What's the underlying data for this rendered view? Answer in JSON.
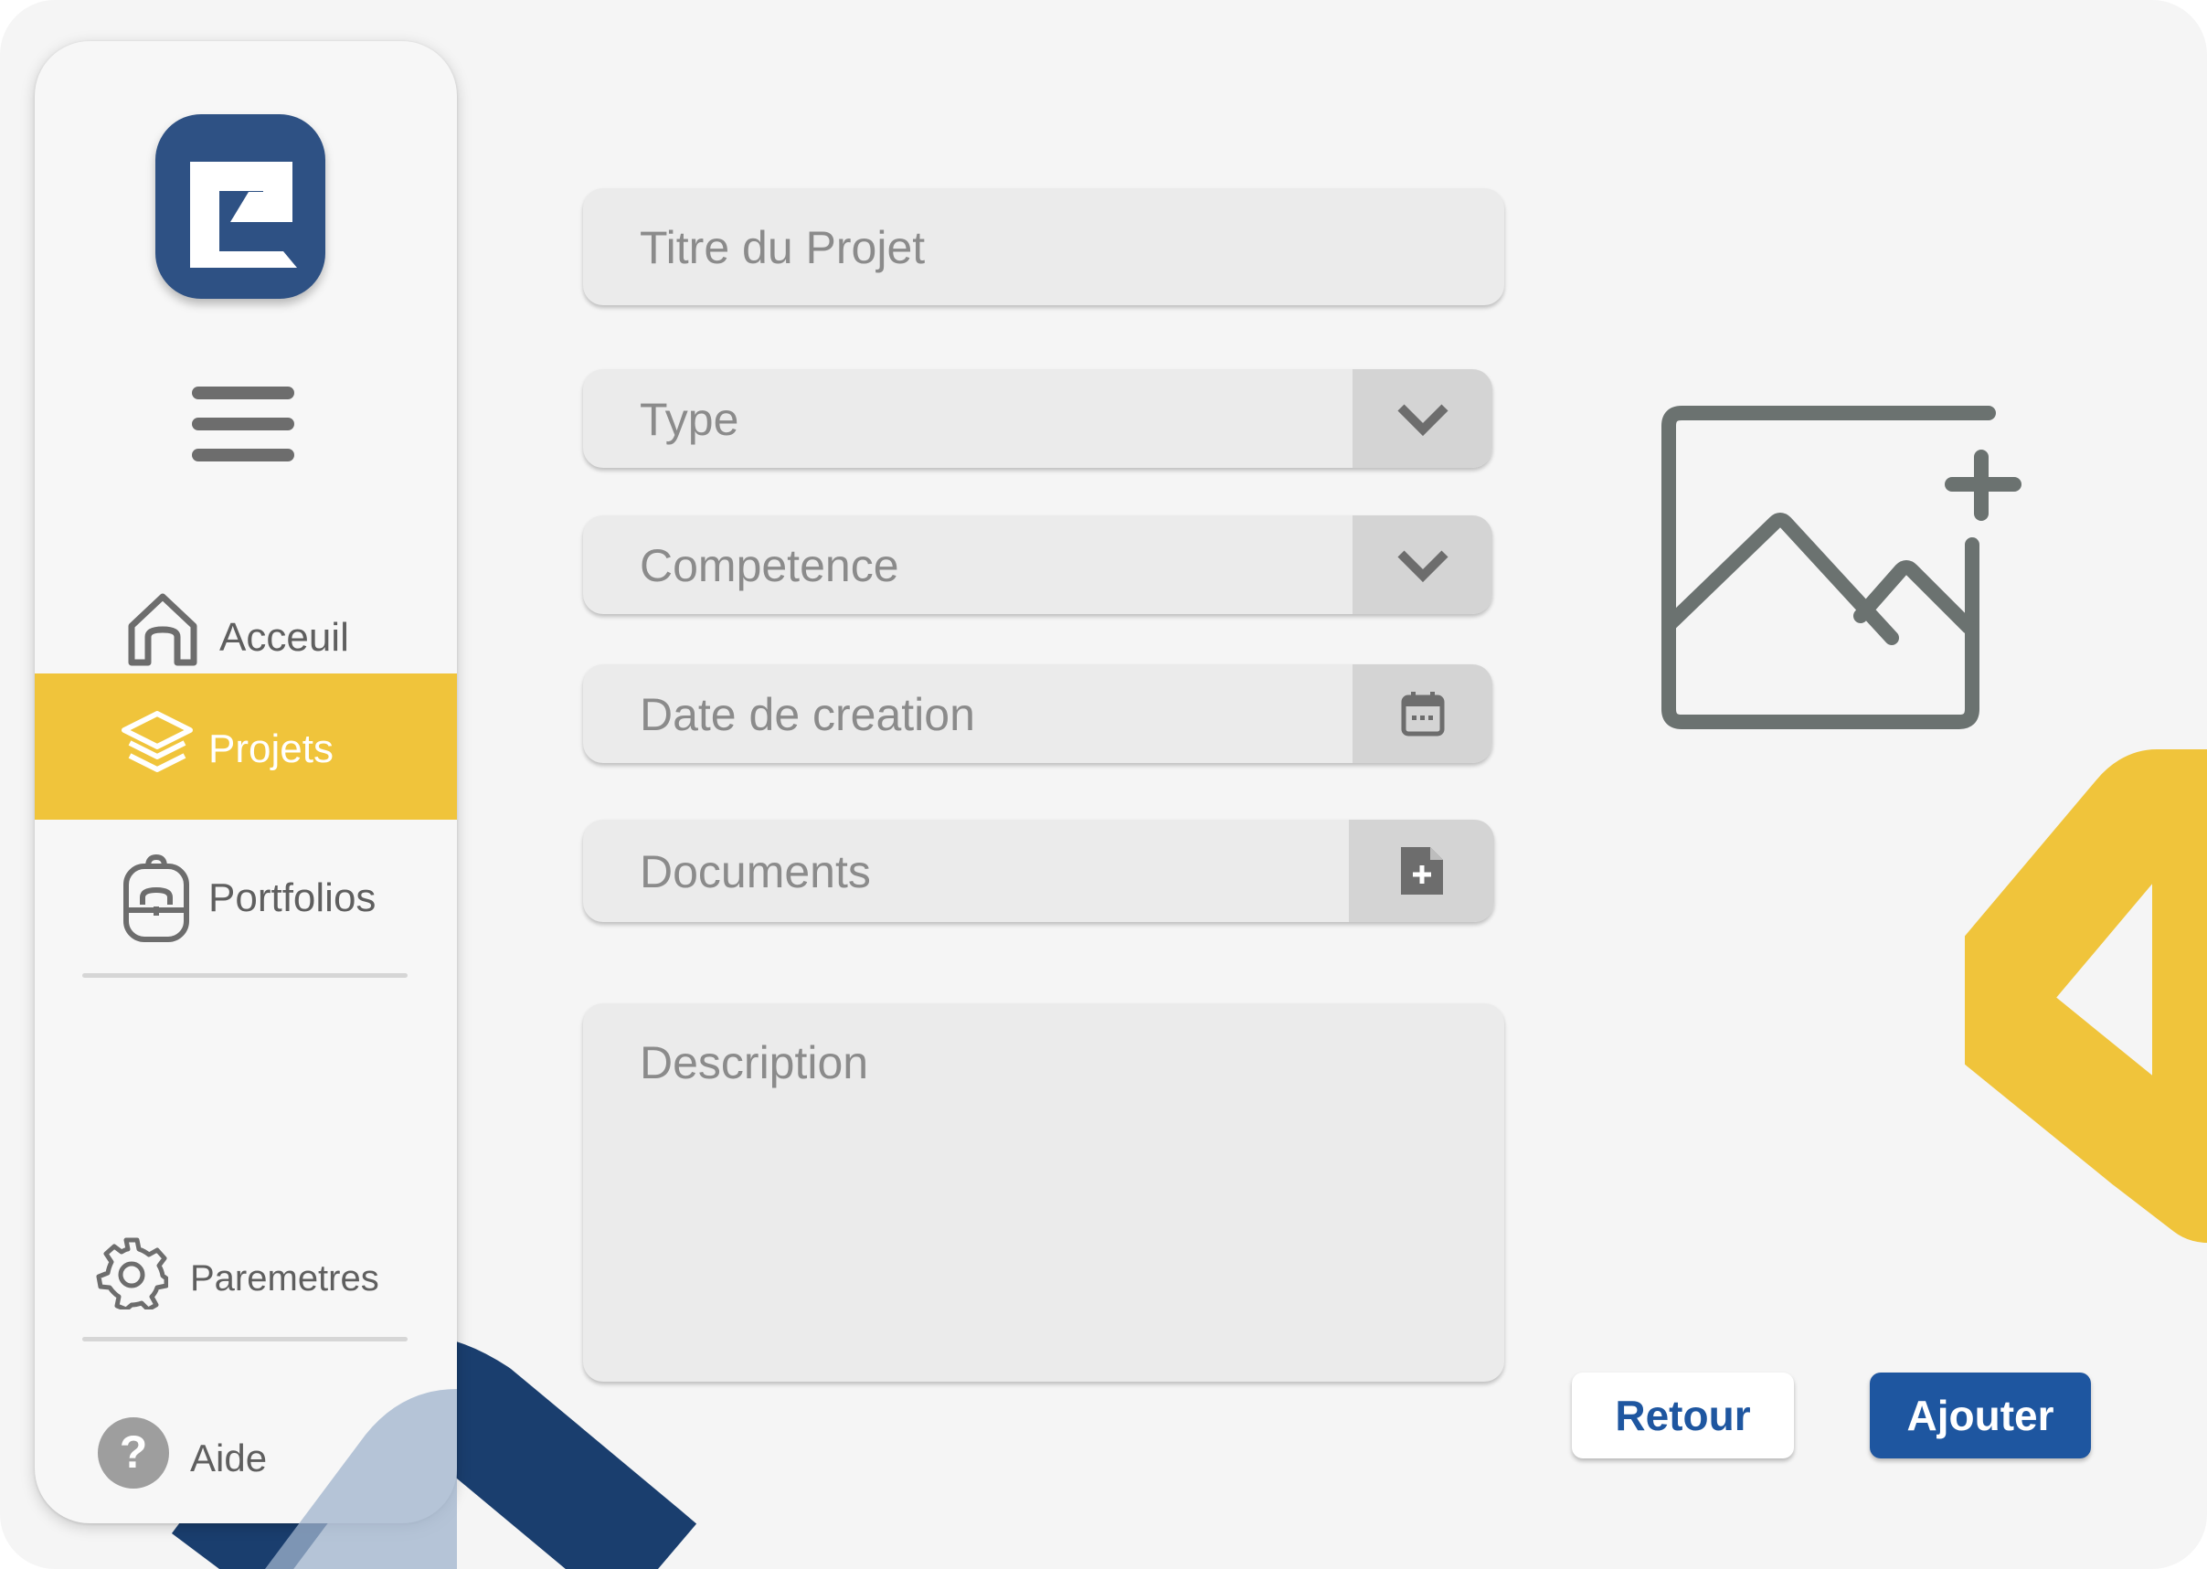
{
  "nav": {
    "items": [
      {
        "label": "Acceuil",
        "icon": "home-icon"
      },
      {
        "label": "Projets",
        "icon": "layers-icon"
      },
      {
        "label": "Portfolios",
        "icon": "backpack-icon"
      }
    ],
    "settings": {
      "label": "Paremetres",
      "icon": "gear-icon"
    },
    "help": {
      "label": "Aide",
      "icon": "help-icon"
    }
  },
  "form": {
    "title_placeholder": "Titre du Projet",
    "type_placeholder": "Type",
    "competence_placeholder": "Competence",
    "date_placeholder": "Date de creation",
    "documents_placeholder": "Documents",
    "description_placeholder": "Description"
  },
  "actions": {
    "back_label": "Retour",
    "add_label": "Ajouter"
  },
  "colors": {
    "accent_yellow": "#f0c43b",
    "brand_blue": "#2e5184",
    "button_blue": "#1e56a0",
    "deco_navy": "#1a3e6e"
  }
}
